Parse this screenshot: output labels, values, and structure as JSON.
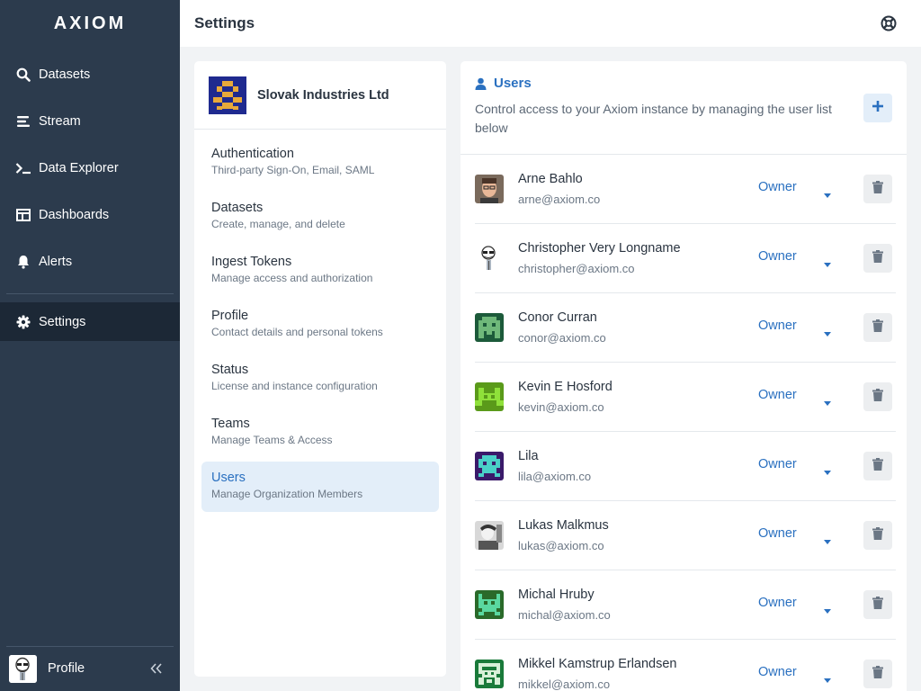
{
  "app": {
    "logo": "AXIOM"
  },
  "nav": {
    "items": [
      {
        "label": "Datasets",
        "icon": "search-icon"
      },
      {
        "label": "Stream",
        "icon": "stream-icon"
      },
      {
        "label": "Data Explorer",
        "icon": "terminal-icon"
      },
      {
        "label": "Dashboards",
        "icon": "dashboard-icon"
      },
      {
        "label": "Alerts",
        "icon": "bell-icon"
      }
    ],
    "settings": {
      "label": "Settings",
      "icon": "gear-icon",
      "active": true
    },
    "profile": {
      "label": "Profile"
    }
  },
  "header": {
    "title": "Settings"
  },
  "org": {
    "name": "Slovak Industries Ltd"
  },
  "settings_menu": [
    {
      "title": "Authentication",
      "subtitle": "Third-party Sign-On, Email, SAML"
    },
    {
      "title": "Datasets",
      "subtitle": "Create, manage, and delete"
    },
    {
      "title": "Ingest Tokens",
      "subtitle": "Manage access and authorization"
    },
    {
      "title": "Profile",
      "subtitle": "Contact details and personal tokens"
    },
    {
      "title": "Status",
      "subtitle": "License and instance configuration"
    },
    {
      "title": "Teams",
      "subtitle": "Manage Teams & Access"
    },
    {
      "title": "Users",
      "subtitle": "Manage Organization Members"
    }
  ],
  "users": {
    "title": "Users",
    "description": "Control access to your Axiom instance by managing the user list below",
    "list": [
      {
        "name": "Arne Bahlo",
        "email": "arne@axiom.co",
        "role": "Owner"
      },
      {
        "name": "Christopher Very Longname",
        "email": "christopher@axiom.co",
        "role": "Owner"
      },
      {
        "name": "Conor Curran",
        "email": "conor@axiom.co",
        "role": "Owner"
      },
      {
        "name": "Kevin E Hosford",
        "email": "kevin@axiom.co",
        "role": "Owner"
      },
      {
        "name": "Lila",
        "email": "lila@axiom.co",
        "role": "Owner"
      },
      {
        "name": "Lukas Malkmus",
        "email": "lukas@axiom.co",
        "role": "Owner"
      },
      {
        "name": "Michal Hruby",
        "email": "michal@axiom.co",
        "role": "Owner"
      },
      {
        "name": "Mikkel Kamstrup Erlandsen",
        "email": "mikkel@axiom.co",
        "role": "Owner"
      }
    ]
  },
  "colors": {
    "sidebar": "#2c3b4d",
    "sidebar_active": "#1c2836",
    "accent": "#2a70c0",
    "active_bg": "#e3eef9"
  }
}
